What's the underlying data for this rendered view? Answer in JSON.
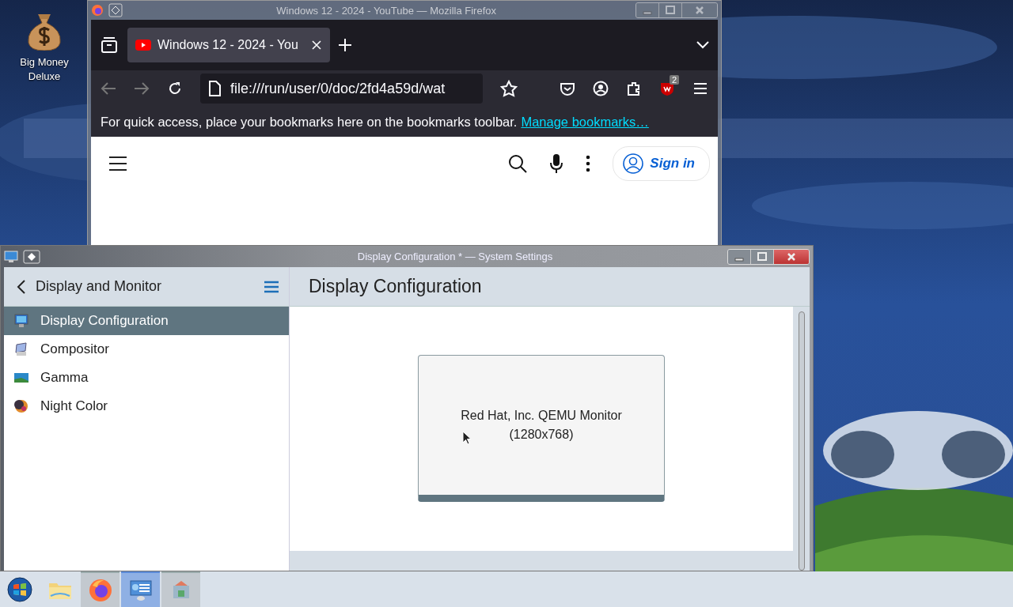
{
  "desktop_icons": [
    {
      "label": "Big Money Deluxe"
    }
  ],
  "browser": {
    "title": "Windows 12 - 2024 - YouTube — Mozilla Firefox",
    "tabs": [
      {
        "label": "Windows 12 - 2024 - You",
        "selected": true
      }
    ],
    "url": "file:///run/user/0/doc/2fd4a59d/wat",
    "extension_badge": "2",
    "bookmarks_hint": "For quick access, place your bookmarks here on the bookmarks toolbar.",
    "bookmarks_link": "Manage bookmarks…",
    "sign_in": "Sign in"
  },
  "settings": {
    "title": "Display Configuration * — System Settings",
    "sidebar": {
      "header": "Display and Monitor",
      "items": [
        {
          "label": "Display Configuration",
          "kind": "display",
          "selected": true
        },
        {
          "label": "Compositor",
          "kind": "compositor",
          "selected": false
        },
        {
          "label": "Gamma",
          "kind": "gamma",
          "selected": false
        },
        {
          "label": "Night Color",
          "kind": "night",
          "selected": false
        }
      ]
    },
    "page_title": "Display Configuration",
    "monitor": {
      "name": "Red Hat, Inc. QEMU Monitor",
      "resolution": "(1280x768)"
    }
  },
  "taskbar": {
    "items": [
      {
        "kind": "start",
        "selected": false
      },
      {
        "kind": "files",
        "selected": false
      },
      {
        "kind": "browser",
        "selected": false
      },
      {
        "kind": "settings",
        "selected": true
      },
      {
        "kind": "tools",
        "selected": false
      }
    ]
  }
}
